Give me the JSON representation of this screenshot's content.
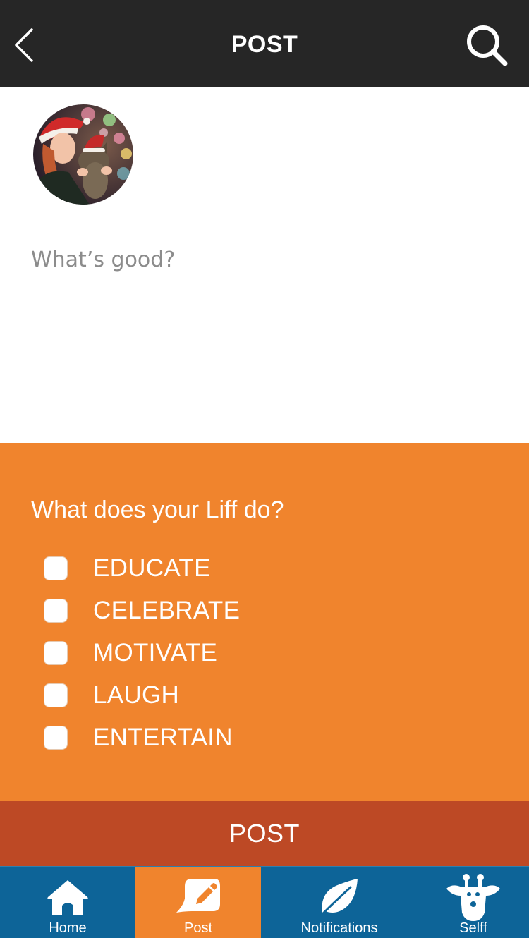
{
  "header": {
    "title": "POST"
  },
  "compose": {
    "placeholder": "What’s good?"
  },
  "panel": {
    "question": "What does your Liff do?",
    "options": [
      {
        "label": "EDUCATE",
        "checked": false
      },
      {
        "label": "CELEBRATE",
        "checked": false
      },
      {
        "label": "MOTIVATE",
        "checked": false
      },
      {
        "label": "LAUGH",
        "checked": false
      },
      {
        "label": "ENTERTAIN",
        "checked": false
      }
    ]
  },
  "post_button": {
    "label": "POST"
  },
  "nav": {
    "items": [
      {
        "label": "Home",
        "icon": "house-icon",
        "active": false
      },
      {
        "label": "Post",
        "icon": "pencil-icon",
        "active": true
      },
      {
        "label": "Notifications",
        "icon": "leaf-icon",
        "active": false
      },
      {
        "label": "Selff",
        "icon": "giraffe-icon",
        "active": false
      }
    ]
  },
  "colors": {
    "header_bg": "#262626",
    "accent_orange": "#f0842d",
    "post_button": "#bd4925",
    "nav_blue": "#0d6498"
  }
}
